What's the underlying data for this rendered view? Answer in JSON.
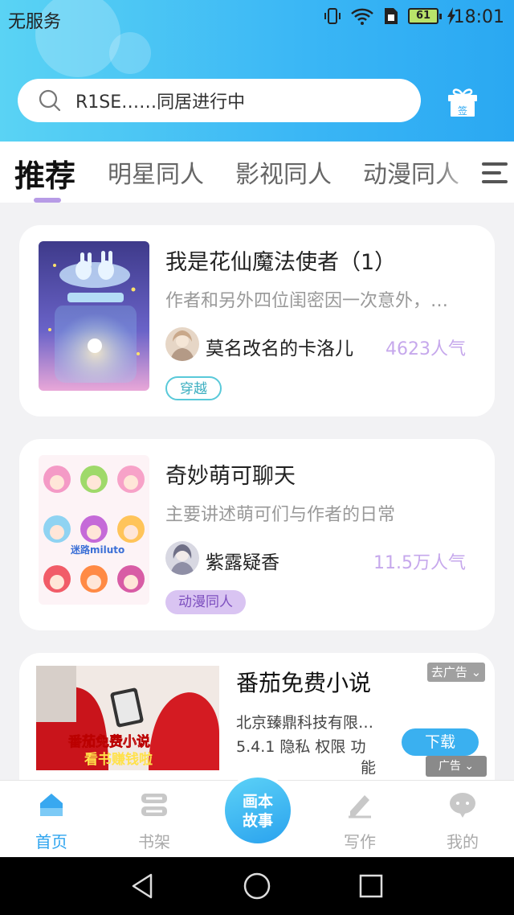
{
  "status_bar": {
    "carrier": "无服务",
    "battery": "61",
    "time": "18:01"
  },
  "search": {
    "placeholder": "R1SE……同居进行中"
  },
  "gift": {
    "label": "签"
  },
  "tabs": [
    {
      "label": "推荐",
      "active": true
    },
    {
      "label": "明星同人"
    },
    {
      "label": "影视同人"
    },
    {
      "label": "动漫同人"
    }
  ],
  "books": [
    {
      "title": "我是花仙魔法使者（1）",
      "description": "作者和另外四位闺密因一次意外，…",
      "author": "莫名改名的卡洛儿",
      "popularity": "4623人气",
      "tag": "穿越"
    },
    {
      "title": "奇妙萌可聊天",
      "description": "主要讲述萌可们与作者的日常",
      "author": "紫露疑香",
      "popularity": "11.5万人气",
      "tag": "动漫同人",
      "cover_text": "迷路miluto"
    }
  ],
  "ad": {
    "title": "番茄免费小说",
    "company": "北京臻鼎科技有限…",
    "meta": "5.4.1  隐私  权限  功",
    "meta_cont": "能",
    "close_label": "去广告",
    "download_label": "下载",
    "ad_label": "广告",
    "banner_text_1": "番茄免费小说",
    "banner_text_2": "看书赚钱啦"
  },
  "bottom_nav": [
    {
      "label": "首页",
      "active": true
    },
    {
      "label": "书架"
    },
    {
      "label": "画本故事",
      "center": true,
      "line1": "画本",
      "line2": "故事"
    },
    {
      "label": "写作"
    },
    {
      "label": "我的"
    }
  ],
  "colors": {
    "accent": "#2ea4ef",
    "header_start": "#5ad3f4",
    "header_end": "#2aa8f2",
    "popularity": "#c6a8ec",
    "tab_underline": "#b79be6"
  }
}
